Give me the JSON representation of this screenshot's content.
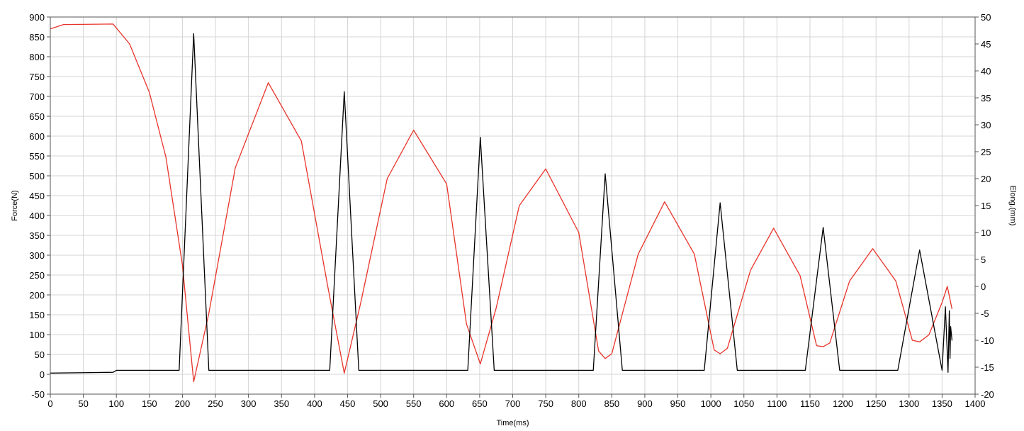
{
  "chart_data": {
    "type": "line",
    "title": "",
    "xlabel": "Time(ms)",
    "ylabel_left": "Force(N)",
    "ylabel_right": "Elong.(mm)",
    "xlim": [
      0,
      1400
    ],
    "ylim_left": [
      -50,
      900
    ],
    "ylim_right": [
      -20,
      50
    ],
    "x_ticks": [
      "0",
      "50",
      "100",
      "150",
      "200",
      "250",
      "300",
      "350",
      "400",
      "450",
      "500",
      "550",
      "600",
      "650",
      "700",
      "750",
      "800",
      "850",
      "900",
      "950",
      "1000",
      "1050",
      "1100",
      "1150",
      "1200",
      "1250",
      "1300",
      "1350",
      "1400"
    ],
    "y_left_ticks": [
      "-50",
      "0",
      "50",
      "100",
      "150",
      "200",
      "250",
      "300",
      "350",
      "400",
      "450",
      "500",
      "550",
      "600",
      "650",
      "700",
      "750",
      "800",
      "850",
      "900"
    ],
    "y_right_ticks": [
      "-20",
      "-15",
      "-10",
      "-5",
      "0",
      "5",
      "10",
      "15",
      "20",
      "25",
      "30",
      "35",
      "40",
      "45",
      "50"
    ],
    "grid": true,
    "colors": {
      "force": "#000000",
      "elong": "#e8332a",
      "grid": "#d4d4d4",
      "axis": "#555555"
    },
    "series": [
      {
        "axis": "left",
        "color": "#000000",
        "x": [
          0,
          95,
          100,
          195,
          217,
          240,
          423,
          445,
          467,
          632,
          651,
          672,
          822,
          840,
          866,
          990,
          1014,
          1040,
          1143,
          1170,
          1195,
          1283,
          1316,
          1350,
          1355,
          1359,
          1361,
          1362,
          1363,
          1365
        ],
        "y": [
          3,
          5,
          10,
          10,
          858,
          10,
          10,
          712,
          10,
          10,
          597,
          10,
          10,
          505,
          10,
          10,
          432,
          10,
          10,
          370,
          10,
          10,
          313,
          10,
          170,
          5,
          160,
          40,
          120,
          85
        ]
      },
      {
        "axis": "right",
        "color": "#e8332a",
        "x": [
          0,
          20,
          95,
          120,
          150,
          175,
          200,
          217,
          240,
          280,
          330,
          380,
          420,
          445,
          470,
          510,
          550,
          600,
          630,
          651,
          675,
          710,
          750,
          800,
          830,
          840,
          850,
          890,
          930,
          975,
          1005,
          1014,
          1025,
          1060,
          1095,
          1135,
          1160,
          1170,
          1180,
          1210,
          1245,
          1280,
          1305,
          1316,
          1330,
          1350,
          1358,
          1365
        ],
        "y": [
          47.8,
          48.6,
          48.7,
          45,
          36,
          24,
          4,
          -17.7,
          -5,
          22,
          37.8,
          27,
          0,
          -16.1,
          -3,
          20,
          29,
          19,
          -7,
          -14.4,
          -4,
          15,
          21.8,
          10,
          -12,
          -13.4,
          -12.5,
          6,
          15.7,
          6,
          -11.8,
          -12.5,
          -11.5,
          3,
          10.8,
          2,
          -11,
          -11.2,
          -10.5,
          1,
          7,
          1,
          -10,
          -10.3,
          -9,
          -3,
          0,
          -4.2
        ]
      }
    ]
  }
}
